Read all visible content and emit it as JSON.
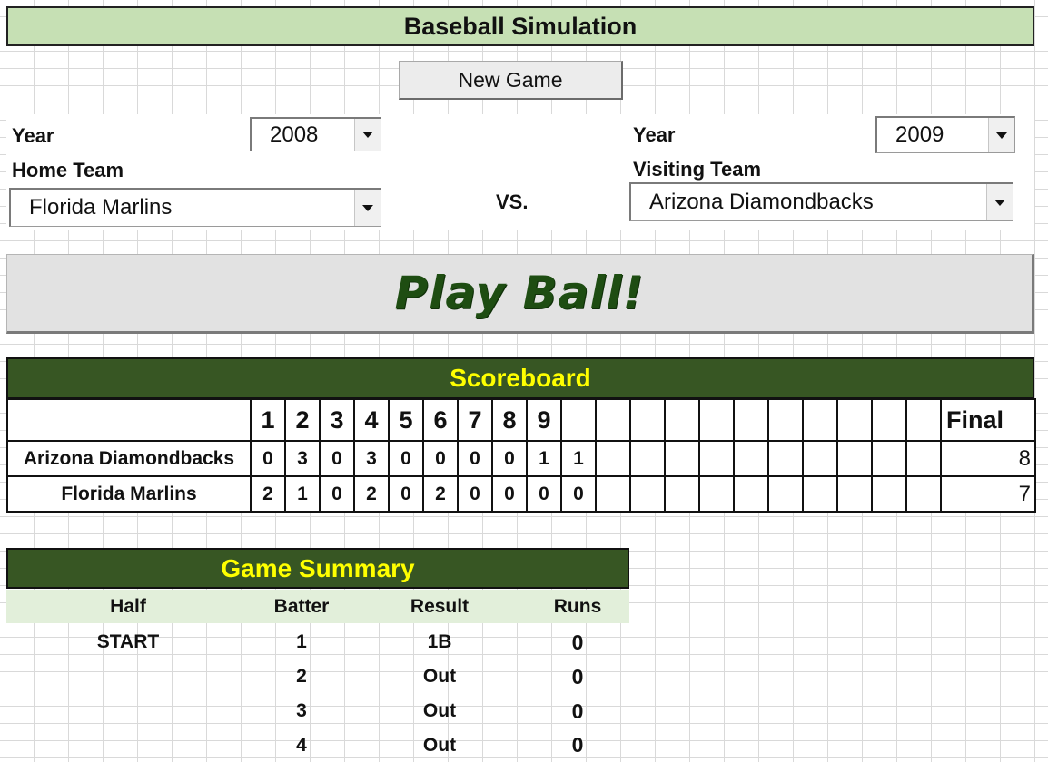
{
  "title": "Baseball Simulation",
  "new_game_label": "New Game",
  "home": {
    "year_label": "Year",
    "year_value": "2008",
    "team_label": "Home Team",
    "team_value": "Florida Marlins"
  },
  "visitor": {
    "year_label": "Year",
    "year_value": "2009",
    "team_label": "Visiting Team",
    "team_value": "Arizona Diamondbacks"
  },
  "vs_label": "VS.",
  "play_ball_label": "Play Ball!",
  "scoreboard": {
    "title": "Scoreboard",
    "innings": [
      "1",
      "2",
      "3",
      "4",
      "5",
      "6",
      "7",
      "8",
      "9",
      "",
      "",
      "",
      "",
      "",
      "",
      "",
      "",
      "",
      "",
      ""
    ],
    "final_label": "Final",
    "rows": [
      {
        "team": "Arizona Diamondbacks",
        "scores": [
          "0",
          "3",
          "0",
          "3",
          "0",
          "0",
          "0",
          "0",
          "1",
          "1",
          "",
          "",
          "",
          "",
          "",
          "",
          "",
          "",
          "",
          ""
        ],
        "final": "8"
      },
      {
        "team": "Florida Marlins",
        "scores": [
          "2",
          "1",
          "0",
          "2",
          "0",
          "2",
          "0",
          "0",
          "0",
          "0",
          "",
          "",
          "",
          "",
          "",
          "",
          "",
          "",
          "",
          ""
        ],
        "final": "7"
      }
    ]
  },
  "summary": {
    "title": "Game Summary",
    "columns": {
      "half": "Half",
      "batter": "Batter",
      "result": "Result",
      "runs": "Runs"
    },
    "rows": [
      {
        "half": "START",
        "batter": "1",
        "result": "1B",
        "runs": "0"
      },
      {
        "half": "",
        "batter": "2",
        "result": "Out",
        "runs": "0"
      },
      {
        "half": "",
        "batter": "3",
        "result": "Out",
        "runs": "0"
      },
      {
        "half": "",
        "batter": "4",
        "result": "Out",
        "runs": "0"
      }
    ]
  },
  "colors": {
    "title_bg": "#c6e0b4",
    "header_bg": "#375623",
    "header_text": "#ffff00",
    "play_ball_text": "#1e4d12",
    "summary_cols_bg": "#e2efda"
  }
}
